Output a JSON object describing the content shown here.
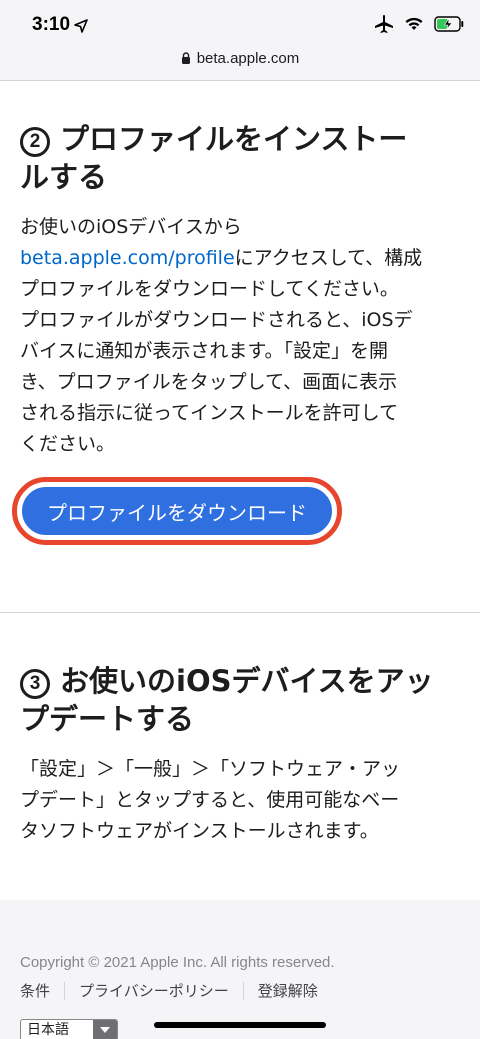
{
  "status_bar": {
    "time": "3:10",
    "icons": [
      "location-arrow-icon",
      "airplane-icon",
      "wifi-icon",
      "battery-charging-icon"
    ]
  },
  "url_bar": {
    "domain": "beta.apple.com"
  },
  "step2": {
    "number": "2",
    "title_line1": "プロファイルをインストー",
    "title_line2": "ルする",
    "lines": [
      "お使いのiOSデバイスから",
      "にアクセスして、構成",
      "プロファイルをダウンロードしてください。",
      "プロファイルがダウンロードされると、iOSデ",
      "バイスに通知が表示されます。「設定」を開",
      "き、プロファイルをタップして、画面に表示",
      "される指示に従ってインストールを許可して",
      "ください。"
    ],
    "link_text": "beta.apple.com/profile",
    "button_label": "プロファイルをダウンロード"
  },
  "step3": {
    "number": "3",
    "title_line1": "お使いのiOSデバイスをアッ",
    "title_line2": "プデートする",
    "lines": [
      "「設定」＞「一般」＞「ソフトウェア・アッ",
      "プデート」とタップすると、使用可能なベー",
      "タソフトウェアがインストールされます。"
    ]
  },
  "footer": {
    "copyright": "Copyright © 2021 Apple Inc. All rights reserved.",
    "links": [
      "条件",
      "プライバシーポリシー",
      "登録解除"
    ],
    "language": "日本語"
  },
  "colors": {
    "link": "#0066cc",
    "button": "#2f6fe0",
    "button_highlight": "#e8452e"
  }
}
